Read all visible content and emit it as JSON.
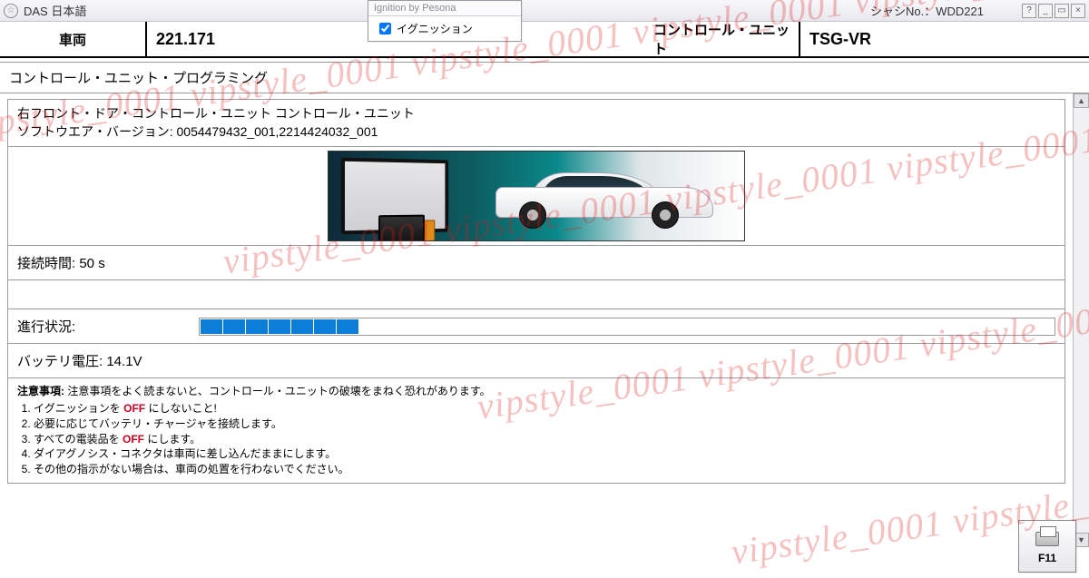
{
  "titlebar": {
    "app_title": "DAS 日本語",
    "chassis_label": "シャシNo.：",
    "chassis_no": "WDD221"
  },
  "ignition_dropdown": {
    "title": "Ignition by Pesona",
    "item_label": "イグニッション",
    "checked": true
  },
  "header": {
    "vehicle_label": "車両",
    "vehicle_value": "221.171",
    "cu_label": "コントロール・ユニット",
    "cu_value": "TSG-VR"
  },
  "section_title": "コントロール・ユニット・プログラミング",
  "sw_info": {
    "line1": "右フロント・ドア・コントロール・ユニット コントロール・ユニット",
    "line2_label": "ソフトウエア・バージョン: ",
    "line2_value": "0054479432_001,2214424032_001"
  },
  "connection": {
    "label": "接続時間: ",
    "value": "50 s"
  },
  "progress": {
    "label": "進行状況:",
    "blocks": 7
  },
  "battery": {
    "label": "バッテリ電圧: ",
    "value": "14.1V"
  },
  "notes": {
    "header": "注意事項: ",
    "header_text": "注意事項をよく読まないと、コントロール・ユニットの破壊をまねく恐れがあります。",
    "items": [
      "イグニッションを OFF にしないこと!",
      "必要に応じてバッテリ・チャージャを接続します。",
      "すべての電装品を OFF にします。",
      "ダイアグノシス・コネクタは車両に差し込んだままにします。",
      "その他の指示がない場合は、車両の処置を行わないでください。"
    ]
  },
  "footer": {
    "f11_label": "F11"
  },
  "watermark": "vipstyle_0001 vipstyle_0001 vipstyle_0001 vipstyle_0001 vipstyle_0001"
}
